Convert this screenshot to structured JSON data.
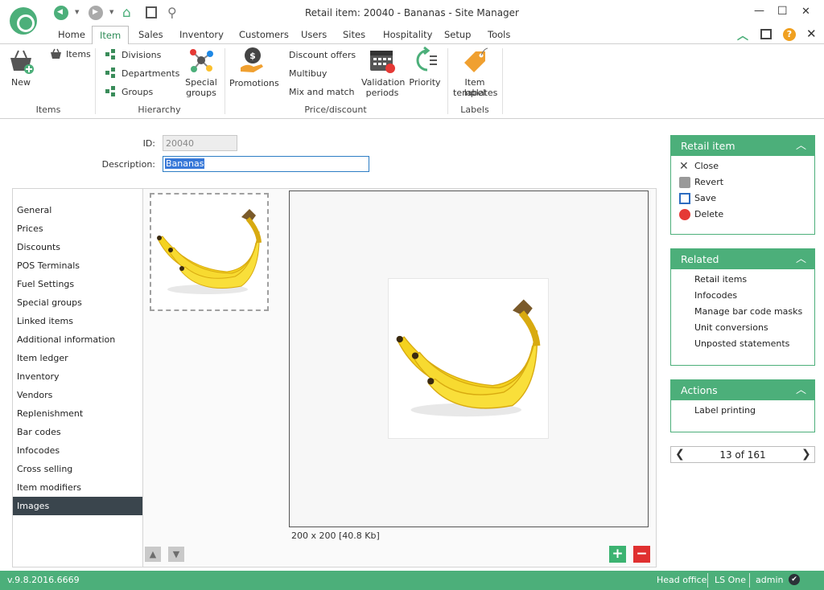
{
  "window": {
    "title": "Retail item: 20040 - Bananas - Site Manager",
    "minimize": "—",
    "maximize": "☐",
    "close": "✕"
  },
  "ribbon": {
    "tabs": [
      "Home",
      "Item",
      "Sales",
      "Inventory",
      "Customers",
      "Users",
      "Sites",
      "Hospitality",
      "Setup",
      "Tools"
    ],
    "active_tab": "Item",
    "groups": {
      "items": {
        "label": "Items",
        "new_label": "New",
        "items_label": "Items"
      },
      "hierarchy": {
        "label": "Hierarchy",
        "divisions": "Divisions",
        "departments": "Departments",
        "groups": "Groups",
        "special_groups_1": "Special",
        "special_groups_2": "groups"
      },
      "price_discount": {
        "label": "Price/discount",
        "promotions": "Promotions",
        "discount_offers": "Discount offers",
        "multibuy": "Multibuy",
        "mix_and_match": "Mix and match",
        "validation_1": "Validation",
        "validation_2": "periods",
        "priority": "Priority"
      },
      "labels": {
        "label": "Labels",
        "item_label_1": "Item label",
        "item_label_2": "templates"
      }
    },
    "help": "?"
  },
  "form": {
    "id_label": "ID:",
    "id_value": "20040",
    "description_label": "Description:",
    "description_value": "Bananas"
  },
  "nav": {
    "items": [
      "General",
      "Prices",
      "Discounts",
      "POS Terminals",
      "Fuel Settings",
      "Special groups",
      "Linked items",
      "Additional information",
      "Item ledger",
      "Inventory",
      "Vendors",
      "Replenishment",
      "Bar codes",
      "Infocodes",
      "Cross selling",
      "Item modifiers",
      "Images"
    ],
    "active": "Images"
  },
  "images": {
    "size_text": "200 x 200 [40.8 Kb]",
    "move_up": "▲",
    "move_down": "▼",
    "add": "+",
    "remove": "−"
  },
  "panels": {
    "retail_item": {
      "title": "Retail item",
      "actions": [
        "Close",
        "Revert",
        "Save",
        "Delete"
      ]
    },
    "related": {
      "title": "Related",
      "links": [
        "Retail items",
        "Infocodes",
        "Manage bar code masks",
        "Unit conversions",
        "Unposted statements"
      ]
    },
    "actions": {
      "title": "Actions",
      "links": [
        "Label printing"
      ]
    }
  },
  "pager": {
    "text": "13 of 161",
    "prev": "❮",
    "next": "❯"
  },
  "status": {
    "version": "v.9.8.2016.6669",
    "location": "Head office",
    "product": "LS One",
    "user": "admin"
  },
  "colors": {
    "accent": "#4caf7a",
    "selected_nav": "#3a454d",
    "add_button": "#3cb371",
    "remove_button": "#e03030"
  }
}
